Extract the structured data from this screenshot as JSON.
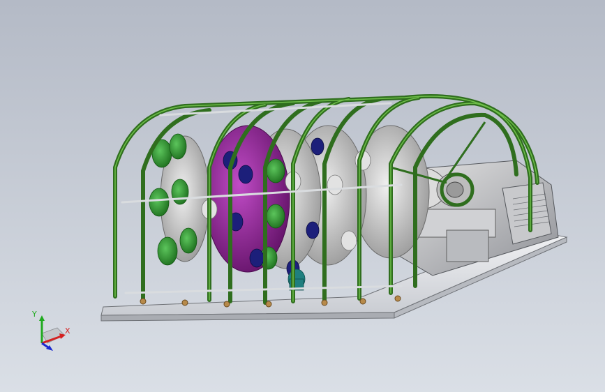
{
  "view": {
    "background_top": "#b4bac6",
    "background_bottom": "#dadfe6"
  },
  "model": {
    "frame_color": "#2f6e1e",
    "frame_highlight": "#6fbf4a",
    "disc_color": "#cfcfcf",
    "purple_part_color": "#8a1f8f",
    "green_part_color": "#2a8a2a",
    "navy_part_color": "#1c1f7a",
    "teal_part_color": "#1f7f7f",
    "base_color": "#e4e6ea"
  },
  "triad": {
    "x_label": "X",
    "y_label": "Y",
    "x_color": "#d42020",
    "y_color": "#1faa1f",
    "z_color": "#1c2ad0"
  }
}
